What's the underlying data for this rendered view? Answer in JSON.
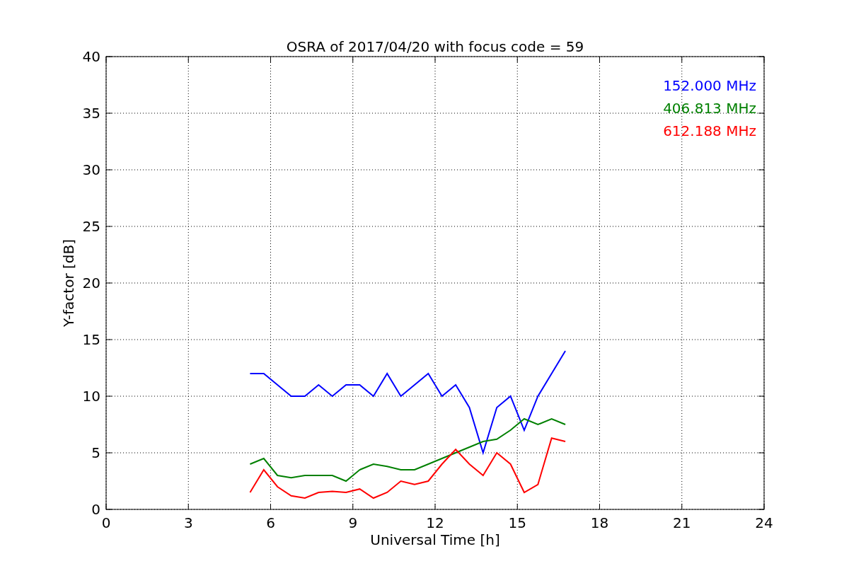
{
  "chart_data": {
    "type": "line",
    "title": "OSRA of 2017/04/20 with focus code = 59",
    "xlabel": "Universal Time [h]",
    "ylabel": "Y-factor [dB]",
    "x": [
      5.25,
      5.75,
      6.25,
      6.75,
      7.25,
      7.75,
      8.25,
      8.75,
      9.25,
      9.75,
      10.25,
      10.75,
      11.25,
      11.75,
      12.25,
      12.75,
      13.25,
      13.75,
      14.25,
      14.75,
      15.25,
      15.75,
      16.25,
      16.75
    ],
    "series": [
      {
        "name": "152.000 MHz",
        "color": "#0000ff",
        "values": [
          12,
          12,
          11,
          10,
          10,
          11,
          10,
          11,
          11,
          10,
          12,
          10,
          11,
          12,
          10,
          11,
          9,
          5,
          9,
          10,
          7,
          10,
          12,
          14
        ]
      },
      {
        "name": "406.813 MHz",
        "color": "#008000",
        "values": [
          4,
          4.5,
          3,
          2.8,
          3,
          3,
          3,
          2.5,
          3.5,
          4,
          3.8,
          3.5,
          3.5,
          4,
          4.5,
          5,
          5.5,
          6,
          6.2,
          7,
          8,
          7.5,
          8,
          7.5
        ]
      },
      {
        "name": "612.188 MHz",
        "color": "#ff0000",
        "values": [
          1.5,
          3.5,
          2,
          1.2,
          1,
          1.5,
          1.6,
          1.5,
          1.8,
          1,
          1.5,
          2.5,
          2.2,
          2.5,
          4,
          5.3,
          4,
          3,
          5,
          4,
          1.5,
          2.2,
          6.3,
          6
        ]
      }
    ],
    "grid": true,
    "xlim": [
      0,
      24
    ],
    "ylim": [
      0,
      40
    ],
    "xticks": [
      0,
      3,
      6,
      9,
      12,
      15,
      18,
      21,
      24
    ],
    "yticks": [
      0,
      5,
      10,
      15,
      20,
      25,
      30,
      35,
      40
    ]
  }
}
